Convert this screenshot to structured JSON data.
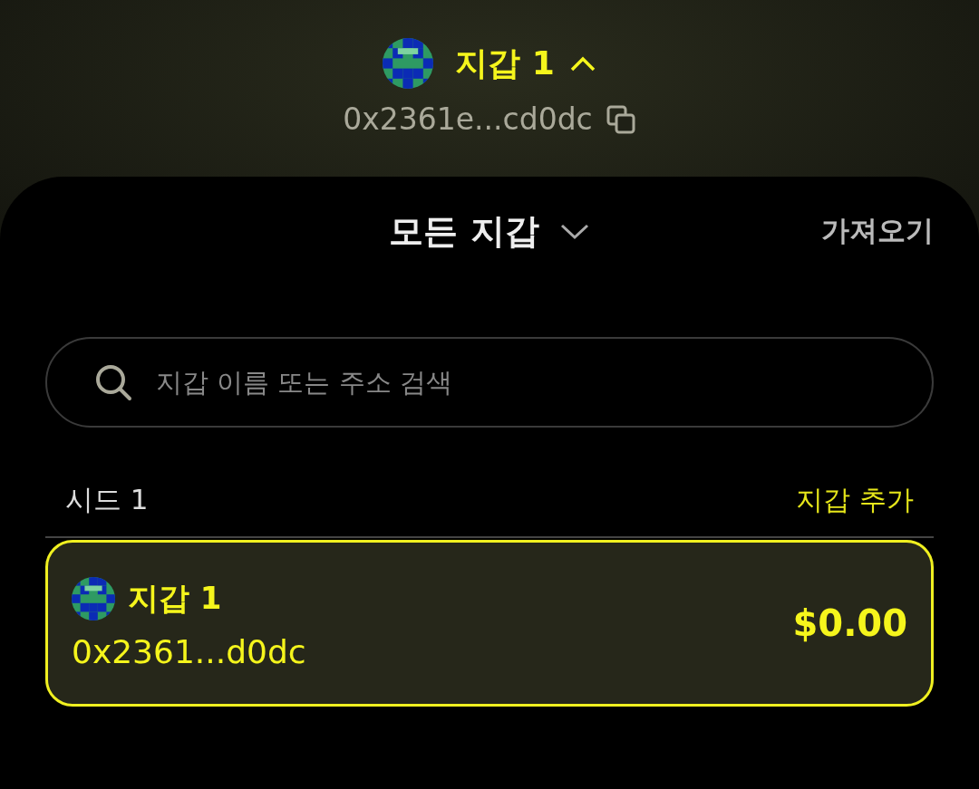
{
  "header": {
    "wallet_name": "지갑 1",
    "expanded": true,
    "address": "0x2361e...cd0dc"
  },
  "sheet": {
    "title": "모든 지갑",
    "import_link": "가져오기",
    "search": {
      "placeholder": "지갑 이름 또는 주소 검색"
    },
    "groups": [
      {
        "name": "시드 1",
        "add_link": "지갑 추가",
        "wallets": [
          {
            "name": "지갑 1",
            "address": "0x2361...d0dc",
            "balance": "$0.00",
            "selected": true
          }
        ]
      }
    ]
  }
}
